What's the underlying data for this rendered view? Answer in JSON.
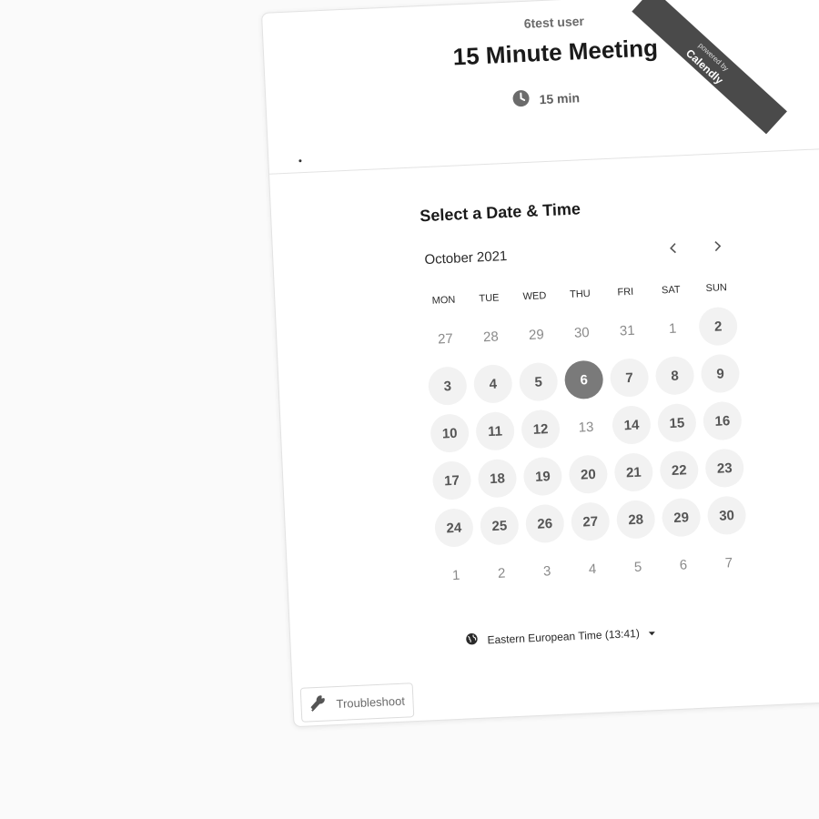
{
  "ribbon": {
    "small": "powered by",
    "label": "Calendly"
  },
  "event": {
    "host": "6test user",
    "title": "15 Minute Meeting",
    "duration": "15 min"
  },
  "booking": {
    "heading": "Select a Date & Time",
    "month": "October 2021",
    "weekdays": [
      "MON",
      "TUE",
      "WED",
      "THU",
      "FRI",
      "SAT",
      "SUN"
    ],
    "weeks": [
      [
        {
          "d": "27",
          "s": "muted"
        },
        {
          "d": "28",
          "s": "muted"
        },
        {
          "d": "29",
          "s": "muted"
        },
        {
          "d": "30",
          "s": "muted"
        },
        {
          "d": "31",
          "s": "muted"
        },
        {
          "d": "1",
          "s": "muted"
        },
        {
          "d": "2",
          "s": "available"
        }
      ],
      [
        {
          "d": "3",
          "s": "available"
        },
        {
          "d": "4",
          "s": "available"
        },
        {
          "d": "5",
          "s": "available"
        },
        {
          "d": "6",
          "s": "selected"
        },
        {
          "d": "7",
          "s": "available"
        },
        {
          "d": "8",
          "s": "available"
        },
        {
          "d": "9",
          "s": "available"
        }
      ],
      [
        {
          "d": "10",
          "s": "available"
        },
        {
          "d": "11",
          "s": "available"
        },
        {
          "d": "12",
          "s": "available"
        },
        {
          "d": "13",
          "s": "muted"
        },
        {
          "d": "14",
          "s": "available"
        },
        {
          "d": "15",
          "s": "available"
        },
        {
          "d": "16",
          "s": "available"
        }
      ],
      [
        {
          "d": "17",
          "s": "available"
        },
        {
          "d": "18",
          "s": "available"
        },
        {
          "d": "19",
          "s": "available"
        },
        {
          "d": "20",
          "s": "available"
        },
        {
          "d": "21",
          "s": "available"
        },
        {
          "d": "22",
          "s": "available"
        },
        {
          "d": "23",
          "s": "available"
        }
      ],
      [
        {
          "d": "24",
          "s": "available"
        },
        {
          "d": "25",
          "s": "available"
        },
        {
          "d": "26",
          "s": "available"
        },
        {
          "d": "27",
          "s": "available"
        },
        {
          "d": "28",
          "s": "available"
        },
        {
          "d": "29",
          "s": "available"
        },
        {
          "d": "30",
          "s": "available"
        }
      ],
      [
        {
          "d": "1",
          "s": "muted"
        },
        {
          "d": "2",
          "s": "muted"
        },
        {
          "d": "3",
          "s": "muted"
        },
        {
          "d": "4",
          "s": "muted"
        },
        {
          "d": "5",
          "s": "muted"
        },
        {
          "d": "6",
          "s": "muted"
        },
        {
          "d": "7",
          "s": "muted"
        }
      ]
    ],
    "timezone": "Eastern European Time (13:41)"
  },
  "footer": {
    "troubleshoot_label": "Troubleshoot"
  },
  "icons": {
    "clock": "clock-icon",
    "prev": "chevron-left-icon",
    "next": "chevron-right-icon",
    "globe": "globe-icon",
    "caret": "caret-down-icon",
    "wrench": "wrench-icon"
  },
  "colors": {
    "selected_day": "#7a7a7a",
    "available_day": "#f2f2f2",
    "ribbon": "#4a4a4a"
  }
}
